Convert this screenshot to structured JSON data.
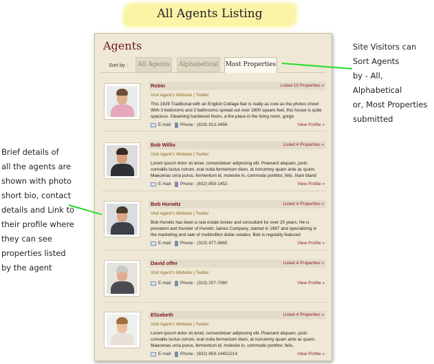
{
  "page_title": "All Agents Listing",
  "annotations": {
    "right": [
      "Site Visitors can",
      "Sort Agents",
      "by - All, Alphabetical",
      "or, Most Properties",
      "submitted"
    ],
    "left": [
      "Brief details of",
      "all the agents are",
      "shown with photo",
      "short bio, contact",
      "details and Link to",
      "their profile where",
      "they can see",
      "properties listed",
      "by the agent"
    ]
  },
  "panel": {
    "title": "Agents",
    "sort_label": "Sort by :",
    "tabs": [
      "All Agents",
      "Alphabetical",
      "Most Properties"
    ],
    "active_tab": "Most Properties"
  },
  "colors": {
    "panel_bg": "#efe8d6",
    "accent": "#7a1515",
    "highlight": "#fbf3a6",
    "annotation_line": "#22dd22"
  },
  "agents": [
    {
      "name": "Robin",
      "listed": "Listed 10 Properties »",
      "website": "Visit Agent's Website",
      "twitter": "Twitter",
      "bio": "This 1929 Traditional with an English Cottage flair is really as cute as the photos show! With 3 bedrooms and 2 bathrooms spread out over 1600 square feet, this house is quite spacious. Gleaming hardwood floors, a fire place in the living room, gorge",
      "email_label": "E-mail",
      "phone": "Phone : (818) 913-3456",
      "view": "View Profile »"
    },
    {
      "name": "Bob Willis",
      "listed": "Listed 4 Properties »",
      "website": "Visit Agent's Website",
      "twitter": "Twitter",
      "bio": "Lorem ipsum dolor sit amet, consectetuer adipiscing elit. Praesent aliquam, justo convallis luctus rutrum, erat nulla fermentum diam, at nonummy quam ante ac quam. Maecenas urna purus, fermentum id, molestie in, commodo porttitor, felis. Nam bland",
      "email_label": "E-mail",
      "phone": "Phone : (832) 859-1452",
      "view": "View Profile »"
    },
    {
      "name": "Bob Hurwitz",
      "listed": "Listed 4 Properties »",
      "website": "Visit Agent's Website",
      "twitter": "Twitter",
      "bio": "Bob Hurwitz has been a real estate broker and consultant for over 25 years. He is president and founder of Hurwitz James Company, started in 1987 and specializing in the marketing and sale of multimillion dollar estates. Bob is regularly featured",
      "email_label": "E-mail",
      "phone": "Phone : (310) 477-8865",
      "view": "View Profile »"
    },
    {
      "name": "David offer",
      "listed": "Listed 4 Properties »",
      "website": "Visit Agent's Website",
      "twitter": "Twitter",
      "bio": "",
      "email_label": "E-mail",
      "phone": "Phone : (310) 207-7080",
      "view": "View Profile »"
    },
    {
      "name": "Elizabeth",
      "listed": "Listed 4 Properties »",
      "website": "Visit Agent's Website",
      "twitter": "Twitter",
      "bio": "Lorem ipsum dolor sit amet, consectetuer adipiscing elit. Praesent aliquam, justo convallis luctus rutrum, erat nulla fermentum diam, at nonummy quam ante ac quam. Maecenas urna purus, fermentum id, molestie in, commodo porttitor, felis.",
      "email_label": "E-mail",
      "phone": "Phone : (832) 859-14452214",
      "view": "View Profile »"
    }
  ]
}
